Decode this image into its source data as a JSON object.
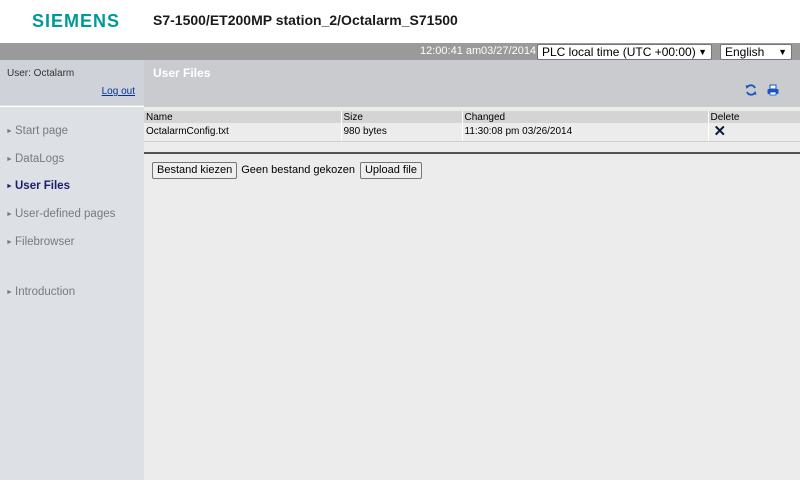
{
  "header": {
    "logo": "SIEMENS",
    "station_title": "S7-1500/ET200MP station_2/Octalarm_S71500"
  },
  "topbar": {
    "time": "12:00:41 am",
    "date": "03/27/2014",
    "timezone": "PLC local time (UTC +00:00)",
    "language": "English"
  },
  "sidebar": {
    "user_label": "User: Octalarm",
    "logout_label": "Log out",
    "items": [
      {
        "label": "Start page"
      },
      {
        "label": "DataLogs"
      },
      {
        "label": "User Files"
      },
      {
        "label": "User-defined pages"
      },
      {
        "label": "Filebrowser"
      },
      {
        "label": "Introduction"
      }
    ],
    "active_item": "User Files"
  },
  "main": {
    "title": "User Files",
    "icons": [
      "refresh-icon",
      "print-icon"
    ],
    "table": {
      "columns": [
        "Name",
        "Size",
        "Changed",
        "Delete"
      ],
      "rows": [
        {
          "name": "OctalarmConfig.txt",
          "size": "980 bytes",
          "changed": "11:30:08 pm 03/26/2014"
        }
      ]
    },
    "upload": {
      "choose_label": "Bestand kiezen",
      "no_file_label": "Geen bestand gekozen",
      "upload_label": "Upload file"
    }
  },
  "colors": {
    "brand": "#009999",
    "topbar": "#9a9a9a",
    "sidebar": "#dde0e5",
    "active_nav": "#1c1c6e",
    "link": "#003399"
  }
}
